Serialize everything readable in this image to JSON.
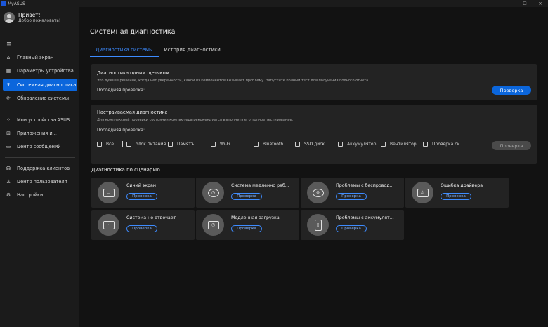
{
  "window": {
    "title": "MyASUS",
    "min": "—",
    "max": "☐",
    "close": "✕"
  },
  "user": {
    "greeting": "Привет!",
    "subtitle": "Добро пожаловать!"
  },
  "sidebar": {
    "menu_icon": "≡",
    "items": [
      {
        "label": "Главный экран",
        "icon": "home-icon",
        "glyph": "⌂",
        "active": false
      },
      {
        "label": "Параметры устройства",
        "icon": "grid-icon",
        "glyph": "▦",
        "active": false
      },
      {
        "label": "Системная диагностика",
        "icon": "stethoscope-icon",
        "glyph": "☤",
        "active": true
      },
      {
        "label": "Обновление системы",
        "icon": "refresh-icon",
        "glyph": "⟳",
        "active": false
      },
      {
        "label": "Мои устройства ASUS",
        "icon": "devices-icon",
        "glyph": "⁘",
        "active": false
      },
      {
        "label": "Приложения и...",
        "icon": "apps-icon",
        "glyph": "⊞",
        "active": false
      },
      {
        "label": "Центр сообщений",
        "icon": "message-icon",
        "glyph": "▭",
        "active": false
      },
      {
        "label": "Поддержка клиентов",
        "icon": "headset-icon",
        "glyph": "☊",
        "active": false
      },
      {
        "label": "Центр пользователя",
        "icon": "user-icon",
        "glyph": "♙",
        "active": false
      },
      {
        "label": "Настройки",
        "icon": "gear-icon",
        "glyph": "⚙",
        "active": false
      }
    ]
  },
  "main": {
    "title": "Системная диагностика",
    "tabs": [
      {
        "label": "Диагностика системы",
        "active": true
      },
      {
        "label": "История диагностики",
        "active": false
      }
    ],
    "one_click": {
      "title": "Диагностика одним щелчком",
      "desc": "Это лучшее решение, когда нет уверенности, какой из компонентов вызывает проблему. Запустите полный тест для получения полного отчета.",
      "last_check": "Последняя проверка:",
      "button": "Проверка"
    },
    "custom": {
      "title": "Настраиваемая диагностика",
      "desc": "Для комплексной проверки состояния компьютера рекомендуется выполнить его полное тестирование.",
      "last_check": "Последняя проверка:",
      "options": [
        "Все",
        "блок питания",
        "Памятъ",
        "Wi-Fi",
        "Bluetooth",
        "SSD диск",
        "Аккумулятор",
        "Вентилятор",
        "Проверка си..."
      ],
      "button": "Проверка"
    },
    "scenarios": {
      "title": "Диагностика по сценарию",
      "button_label": "Проверка",
      "items": [
        {
          "title": "Синий экран",
          "icon": "monitor-icon",
          "glyph": "▭"
        },
        {
          "title": "Система медленно раб...",
          "icon": "speedometer-icon",
          "glyph": "◔"
        },
        {
          "title": "Проблемы с беспровод...",
          "icon": "globe-icon",
          "glyph": "⊕"
        },
        {
          "title": "Ошибка драйвера",
          "icon": "driver-icon",
          "glyph": "⚠"
        },
        {
          "title": "Система не отвечает",
          "icon": "frozen-screen-icon",
          "glyph": "⋯"
        },
        {
          "title": "Медленная загрузка",
          "icon": "slow-boot-icon",
          "glyph": "◷"
        },
        {
          "title": "Проблемы с аккумулят...",
          "icon": "battery-icon",
          "glyph": "▯"
        }
      ]
    }
  },
  "colors": {
    "accent": "#0b66dc",
    "background": "#121212",
    "panel": "#232323",
    "sidebar": "#1b1b1b"
  }
}
